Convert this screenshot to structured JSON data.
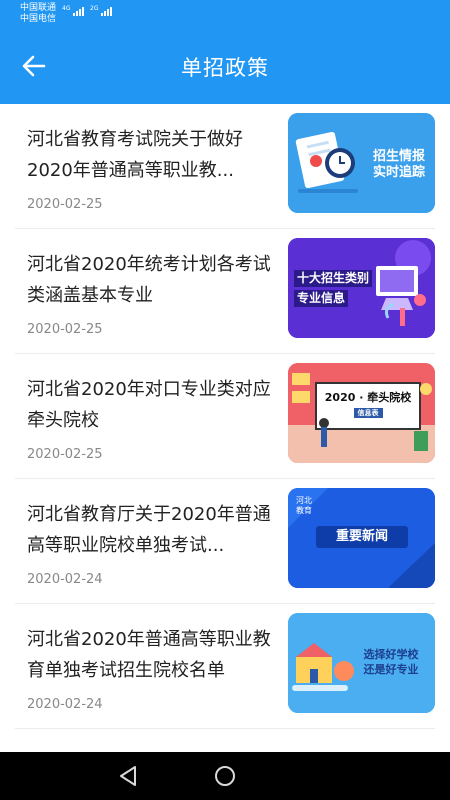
{
  "status_bar": {
    "carrier_1": "中国联通",
    "carrier_2": "中国电信",
    "net_1": "4G",
    "net_2": "2G"
  },
  "header": {
    "title": "单招政策",
    "back_icon": "arrow-left-icon"
  },
  "articles": [
    {
      "title": "河北省教育考试院关于做好2020年普通高等职业教...",
      "date": "2020-02-25",
      "thumb_line1": "招生情报",
      "thumb_line2": "实时追踪"
    },
    {
      "title": "河北省2020年统考计划各考试类涵盖基本专业",
      "date": "2020-02-25",
      "thumb_line1": "十大招生类别",
      "thumb_line2": "专业信息"
    },
    {
      "title": "河北省2020年对口专业类对应牵头院校",
      "date": "2020-02-25",
      "thumb_line1": "2020 · 牵头院校",
      "thumb_line2": "信息表"
    },
    {
      "title": "河北省教育厅关于2020年普通高等职业院校单独考试...",
      "date": "2020-02-24",
      "thumb_line1": "河北\n教育",
      "thumb_line2": "重要新闻"
    },
    {
      "title": "河北省2020年普通高等职业教育单独考试招生院校名单",
      "date": "2020-02-24",
      "thumb_line1": "选择好学校",
      "thumb_line2": "还是好专业"
    }
  ],
  "nav": {
    "back_icon": "triangle-back-icon",
    "home_icon": "circle-home-icon"
  },
  "colors": {
    "primary": "#2196f3",
    "text": "#222222",
    "date": "#888888"
  }
}
